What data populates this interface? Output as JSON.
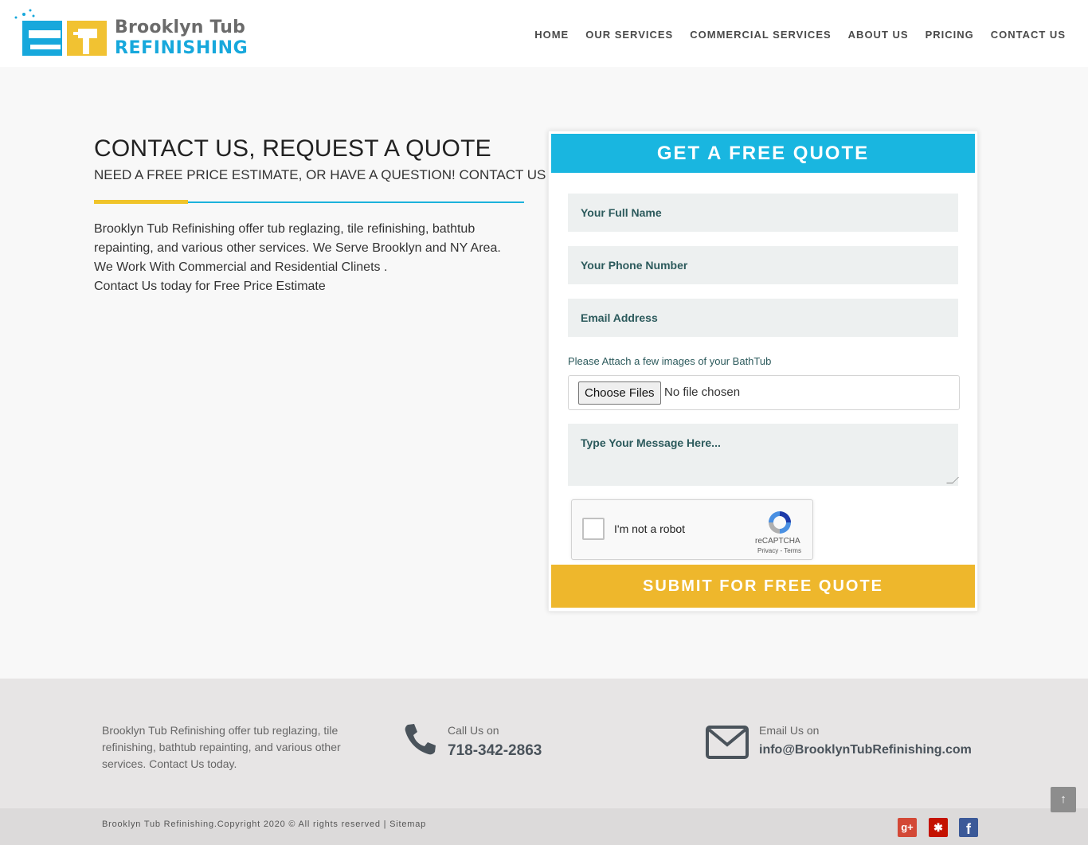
{
  "logo": {
    "line1": "Brooklyn Tub",
    "line2": "REFINISHING"
  },
  "nav": {
    "items": [
      "HOME",
      "OUR SERVICES",
      "COMMERCIAL SERVICES",
      "ABOUT US",
      "PRICING",
      "CONTACT US"
    ]
  },
  "contact": {
    "title": "CONTACT US, REQUEST A QUOTE",
    "subtitle": "NEED A FREE PRICE ESTIMATE, OR HAVE A QUESTION! CONTACT US",
    "intro": {
      "line1": "Brooklyn Tub Refinishing offer tub reglazing, tile refinishing, bathtub",
      "line2": "repainting, and various other services. We Serve Brooklyn and NY Area.",
      "line3": "We Work With Commercial and Residential Clinets .",
      "line4": "Contact Us today for Free Price Estimate"
    }
  },
  "quote_form": {
    "heading": "GET A FREE QUOTE",
    "name_placeholder": "Your Full Name",
    "phone_placeholder": "Your Phone Number",
    "email_placeholder": "Email Address",
    "attach_label": "Please Attach a few images of your BathTub",
    "file_button": "Choose Files",
    "file_status": "No file chosen",
    "message_placeholder": "Type Your Message Here...",
    "captcha": {
      "label": "I'm not a robot",
      "brand": "reCAPTCHA",
      "links": "Privacy - Terms"
    },
    "submit_label": "SUBMIT FOR FREE QUOTE"
  },
  "footer": {
    "about": "Brooklyn Tub Refinishing offer tub reglazing, tile refinishing, bathtub repainting, and various other services. Contact Us today.",
    "call_label": "Call Us on",
    "phone": "718-342-2863",
    "email_label": "Email Us on",
    "email": "info@BrooklynTubRefinishing.com",
    "copyright": "Brooklyn Tub Refinishing.Copyright 2020 © All rights reserved | Sitemap",
    "social": {
      "gplus": "g+",
      "yelp": "✱",
      "facebook": "f"
    },
    "scroll_top": "↑"
  },
  "colors": {
    "accent_blue": "#19b6e0",
    "accent_yellow": "#eeb72c",
    "field_bg": "#edf0f0"
  }
}
